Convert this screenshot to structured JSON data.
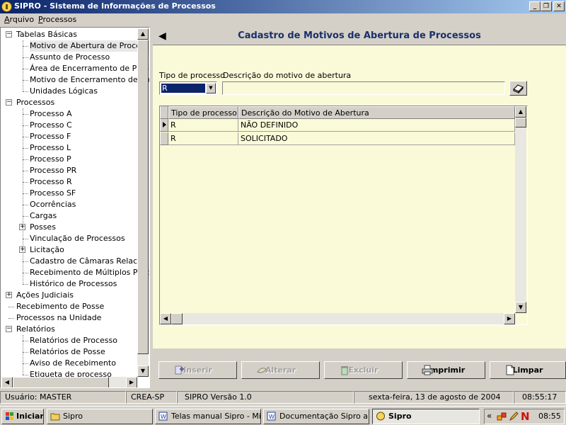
{
  "window": {
    "title": "SIPRO - Sistema de Informações de Processos",
    "minimize_glyph": "_",
    "restore_glyph": "❐",
    "close_glyph": "✕"
  },
  "menu": [
    {
      "label": "Arquivo"
    },
    {
      "label": "Processos"
    }
  ],
  "tree": {
    "groups": [
      {
        "label": "Tabelas Básicas",
        "expanded": true,
        "children": [
          {
            "label": "Motivo de Abertura de Processos",
            "selected": true
          },
          {
            "label": "Assunto de Processo"
          },
          {
            "label": "Área de Encerramento de Processos"
          },
          {
            "label": "Motivo de Encerramento de Processos"
          },
          {
            "label": "Unidades Lógicas"
          }
        ]
      },
      {
        "label": "Processos",
        "expanded": true,
        "children": [
          {
            "label": "Processo A"
          },
          {
            "label": "Processo C"
          },
          {
            "label": "Processo F"
          },
          {
            "label": "Processo L"
          },
          {
            "label": "Processo P"
          },
          {
            "label": "Processo PR"
          },
          {
            "label": "Processo R"
          },
          {
            "label": "Processo SF"
          },
          {
            "label": "Ocorrências"
          },
          {
            "label": "Cargas"
          },
          {
            "label": "Posses",
            "expandable": true
          },
          {
            "label": "Vinculação de Processos"
          },
          {
            "label": "Licitação",
            "expandable": true
          },
          {
            "label": "Cadastro de Câmaras Relacionadas"
          },
          {
            "label": "Recebimento de Múltiplos Processos"
          },
          {
            "label": "Histórico de Processos"
          }
        ]
      },
      {
        "label": "Ações Judiciais",
        "expandable": true
      },
      {
        "label": "Recebimento de Posse"
      },
      {
        "label": "Processos na Unidade"
      },
      {
        "label": "Relatórios",
        "expanded": true,
        "children": [
          {
            "label": "Relatórios de Processo"
          },
          {
            "label": "Relatórios de Posse"
          },
          {
            "label": "Aviso de Recebimento"
          },
          {
            "label": "Etiqueta de processo"
          }
        ]
      }
    ]
  },
  "form": {
    "title": "Cadastro de Motivos de Abertura de Processos",
    "tipo_label": "Tipo de processo",
    "tipo_value": "R",
    "desc_label": "Descrição do motivo de abertura",
    "desc_value": ""
  },
  "grid": {
    "columns": [
      "Tipo de processo",
      "Descrição do Motivo de Abertura"
    ],
    "rows": [
      {
        "tipo": "R",
        "descricao": "NÃO DEFINIDO",
        "current": true
      },
      {
        "tipo": "R",
        "descricao": "SOLICITADO"
      }
    ]
  },
  "buttons": {
    "inserir": "Inserir",
    "alterar": "Alterar",
    "excluir": "Excluir",
    "imprimir": "Imprimir",
    "limpar": "Limpar"
  },
  "status": {
    "user": "Usuário: MASTER",
    "org": "CREA-SP",
    "version": "SIPRO Versão 1.0",
    "date": "sexta-feira, 13 de agosto de 2004",
    "time": "08:55:17"
  },
  "taskbar": {
    "start": "Iniciar",
    "tasks": [
      {
        "label": "Sipro",
        "icon": "folder-icon"
      },
      {
        "label": "Telas manual Sipro - Mi...",
        "icon": "word-icon"
      },
      {
        "label": "Documentação Sipro a...",
        "icon": "word-icon"
      },
      {
        "label": "Sipro",
        "icon": "sipro-icon",
        "active": true
      }
    ],
    "tray_chevron": "«",
    "tray_n": "N",
    "clock": "08:55"
  },
  "colors": {
    "title_bar": "#0a246a",
    "form_background": "#fafad8",
    "selection": "#0a246a",
    "header_text": "#1b2f6b"
  }
}
